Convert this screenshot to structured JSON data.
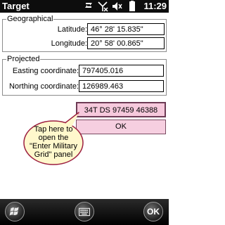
{
  "window": {
    "title": "Target"
  },
  "status": {
    "time": "11:29"
  },
  "geographical": {
    "title": "Geographical",
    "latitude_label": "Latitude:",
    "latitude_value": "46° 28' 15.835\"",
    "longitude_label": "Longitude:",
    "longitude_value": "20° 58' 00.865\""
  },
  "projected": {
    "title": "Projected",
    "easting_label": "Easting coordinate:",
    "easting_value": "797405.016",
    "northing_label": "Northing coordinate:",
    "northing_value": "126989.463"
  },
  "buttons": {
    "military_grid": "34T DS 97459 46388",
    "ok": "OK"
  },
  "callout": {
    "text": "Tap here to open the \"Enter Military Grid\" panel",
    "fill": "#fff8cc",
    "stroke": "#9c1e3f"
  },
  "taskbar": {
    "ok_label": "OK"
  },
  "icons": [
    "network-icon",
    "signal-off-icon",
    "speaker-muted-icon",
    "battery-icon",
    "windows-start-icon",
    "keyboard-icon"
  ]
}
